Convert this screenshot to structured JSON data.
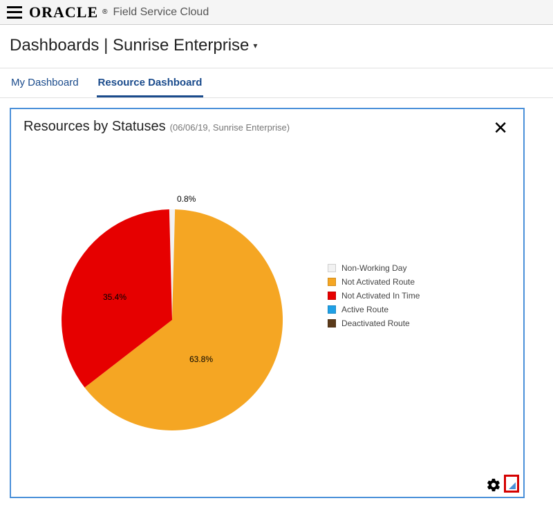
{
  "header": {
    "logo_text": "ORACLE",
    "product_name": "Field Service Cloud"
  },
  "page": {
    "title": "Dashboards | Sunrise Enterprise"
  },
  "tabs": [
    {
      "label": "My Dashboard",
      "active": false
    },
    {
      "label": "Resource Dashboard",
      "active": true
    }
  ],
  "card": {
    "title": "Resources by Statuses",
    "subtitle": "(06/06/19, Sunrise Enterprise)"
  },
  "chart_data": {
    "type": "pie",
    "title": "Resources by Statuses",
    "series": [
      {
        "name": "Non-Working Day",
        "value": 0.8,
        "label": "0.8%",
        "color": "#f2f2f2"
      },
      {
        "name": "Not Activated Route",
        "value": 63.8,
        "label": "63.8%",
        "color": "#f5a623"
      },
      {
        "name": "Not Activated In Time",
        "value": 35.4,
        "label": "35.4%",
        "color": "#e60000"
      },
      {
        "name": "Active Route",
        "value": 0,
        "label": "",
        "color": "#1fa0e6"
      },
      {
        "name": "Deactivated Route",
        "value": 0,
        "label": "",
        "color": "#5b3a1a"
      }
    ]
  }
}
